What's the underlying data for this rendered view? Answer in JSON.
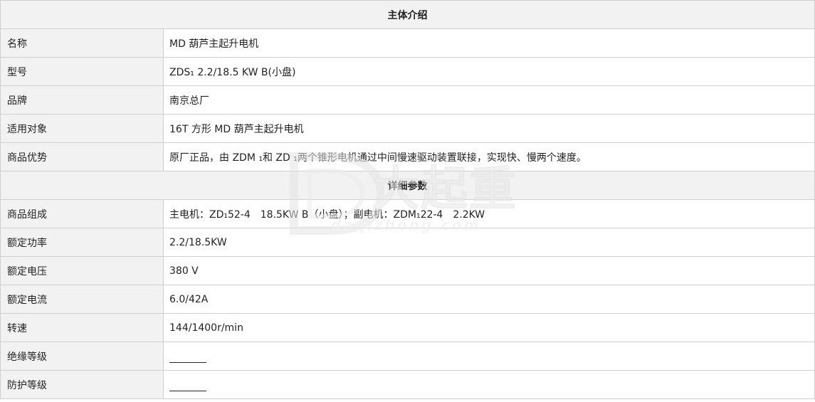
{
  "sections": {
    "intro": {
      "title": "主体介绍",
      "rows": [
        {
          "label": "名称",
          "value": "MD 葫芦主起升电机"
        },
        {
          "label": "型号",
          "value": "ZDS₁ 2.2/18.5 KW B(小盘)"
        },
        {
          "label": "品牌",
          "value": "南京总厂"
        },
        {
          "label": "适用对象",
          "value": "16T 方形 MD 葫芦主起升电机"
        },
        {
          "label": "商品优势",
          "value": "原厂正品，由 ZDM ₁和 ZD ₁两个锥形电机通过中间慢速驱动装置联接，实现快、慢两个速度。"
        }
      ]
    },
    "details": {
      "title": "详细参数",
      "rows": [
        {
          "label": "商品组成",
          "value": "主电机：ZD₁52-4　18.5KW B（小盘）；副电机：ZDM₁22-4　2.2KW"
        },
        {
          "label": "额定功率",
          "value": "2.2/18.5KW"
        },
        {
          "label": "额定电压",
          "value": "380 V"
        },
        {
          "label": "额定电流",
          "value": "6.0/42A"
        },
        {
          "label": "转速",
          "value": "144/1400r/min"
        },
        {
          "label": "绝缘等级",
          "value": ""
        },
        {
          "label": "防护等级",
          "value": ""
        }
      ]
    }
  },
  "watermark": {
    "text": "大起重",
    "url": "daqizhong.com",
    "logo_icon": "d-logo-icon"
  }
}
